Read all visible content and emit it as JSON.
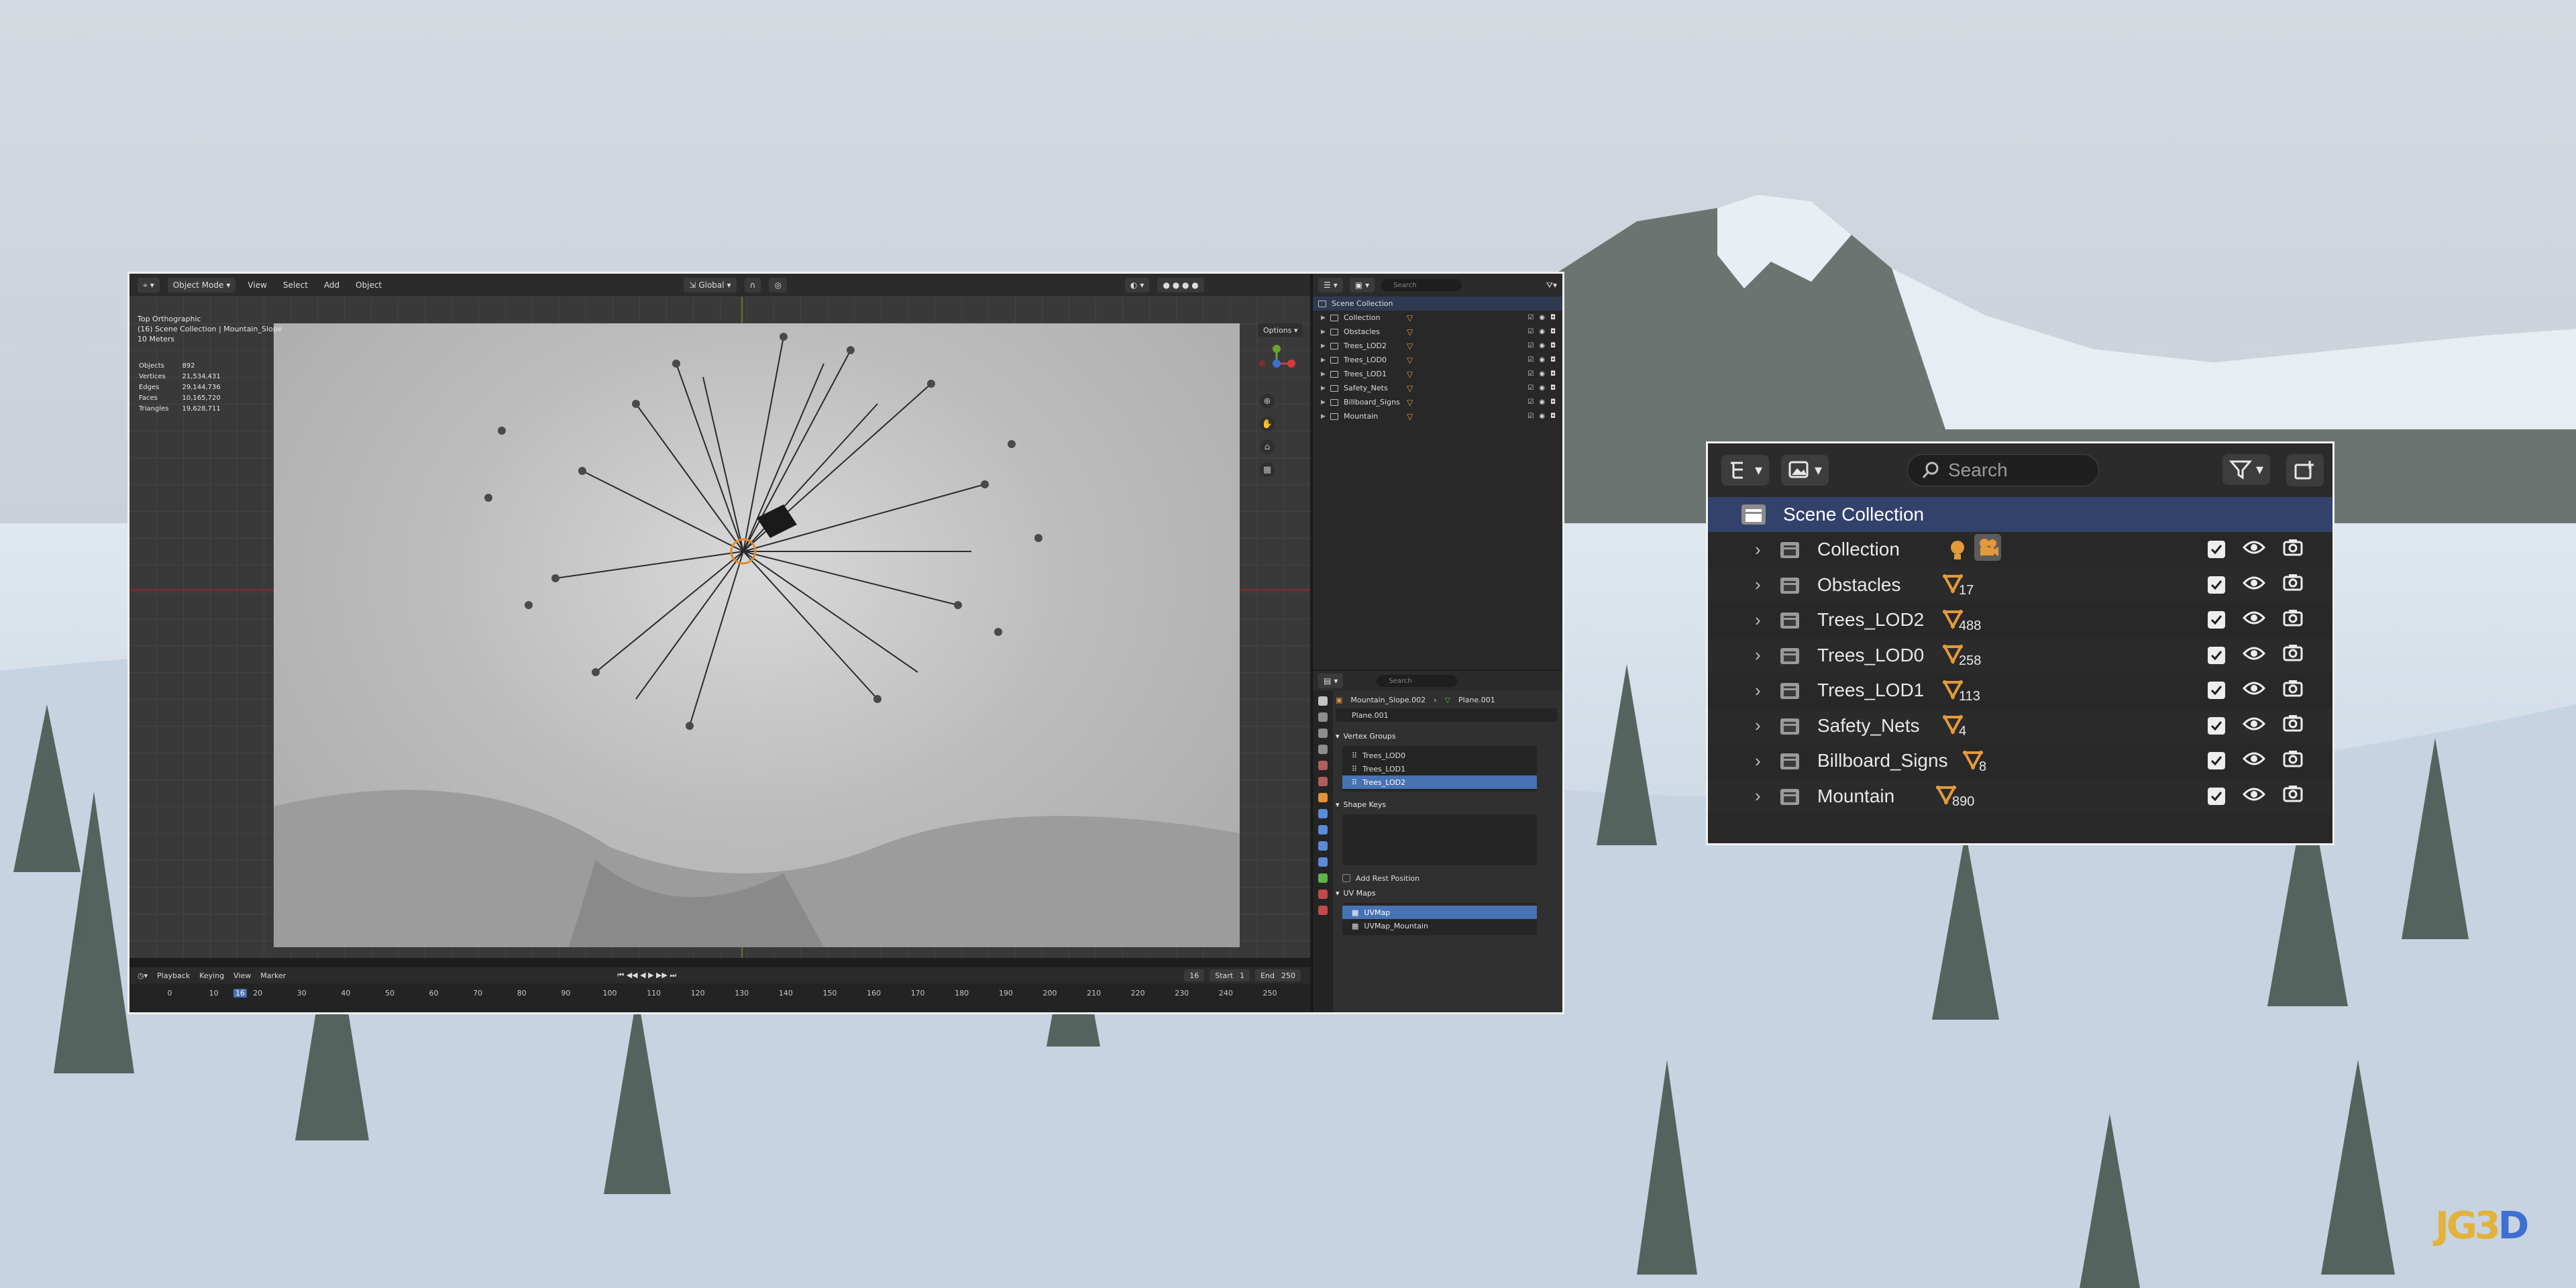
{
  "viewport": {
    "header": {
      "mode": "Object Mode",
      "menus": [
        "View",
        "Select",
        "Add",
        "Object"
      ],
      "orientation": "Global",
      "options_label": "Options"
    },
    "overlay": {
      "view_name": "Top Orthographic",
      "context": "(16) Scene Collection | Mountain_Slope",
      "scale": "10 Meters"
    },
    "stats": [
      {
        "label": "Objects",
        "value": "892"
      },
      {
        "label": "Vertices",
        "value": "21,534,431"
      },
      {
        "label": "Edges",
        "value": "29,144,736"
      },
      {
        "label": "Faces",
        "value": "10,165,720"
      },
      {
        "label": "Triangles",
        "value": "19,628,711"
      }
    ]
  },
  "timeline": {
    "menus": [
      "Playback",
      "Keying",
      "View",
      "Marker"
    ],
    "current_frame": "16",
    "start_label": "Start",
    "start_value": "1",
    "end_label": "End",
    "end_value": "250",
    "ticks": [
      "0",
      "10",
      "20",
      "30",
      "40",
      "50",
      "60",
      "70",
      "80",
      "90",
      "100",
      "110",
      "120",
      "130",
      "140",
      "150",
      "160",
      "170",
      "180",
      "190",
      "200",
      "210",
      "220",
      "230",
      "240",
      "250"
    ]
  },
  "small_outliner": {
    "search_placeholder": "Search",
    "scene_collection": "Scene Collection",
    "rows": [
      "Collection",
      "Obstacles",
      "Trees_LOD2",
      "Trees_LOD0",
      "Trees_LOD1",
      "Safety_Nets",
      "Billboard_Signs",
      "Mountain"
    ]
  },
  "properties": {
    "search_placeholder": "Search",
    "breadcrumb_object": "Mountain_Slope.002",
    "breadcrumb_mesh": "Plane.001",
    "mesh_name": "Plane.001",
    "vertex_groups_title": "Vertex Groups",
    "vertex_groups": [
      "Trees_LOD0",
      "Trees_LOD1",
      "Trees_LOD2"
    ],
    "shape_keys_title": "Shape Keys",
    "add_rest_position": "Add Rest Position",
    "uv_maps_title": "UV Maps",
    "uv_maps": [
      "UVMap",
      "UVMap_Mountain"
    ]
  },
  "zoomed_outliner": {
    "search_placeholder": "Search",
    "scene_collection": "Scene Collection",
    "rows": [
      {
        "name": "Collection",
        "count": "",
        "icons": "light-camera"
      },
      {
        "name": "Obstacles",
        "count": "17",
        "icons": "mesh"
      },
      {
        "name": "Trees_LOD2",
        "count": "488",
        "icons": "mesh"
      },
      {
        "name": "Trees_LOD0",
        "count": "258",
        "icons": "mesh"
      },
      {
        "name": "Trees_LOD1",
        "count": "113",
        "icons": "mesh"
      },
      {
        "name": "Safety_Nets",
        "count": "4",
        "icons": "mesh"
      },
      {
        "name": "Billboard_Signs",
        "count": "8",
        "icons": "mesh"
      },
      {
        "name": "Mountain",
        "count": "890",
        "icons": "mesh"
      }
    ]
  },
  "colors": {
    "accent_blue": "#4772b3",
    "scene_row": "#33426a",
    "mesh_icon": "#e39a3b",
    "panel_bg": "#282828"
  },
  "watermark": "JG3D"
}
